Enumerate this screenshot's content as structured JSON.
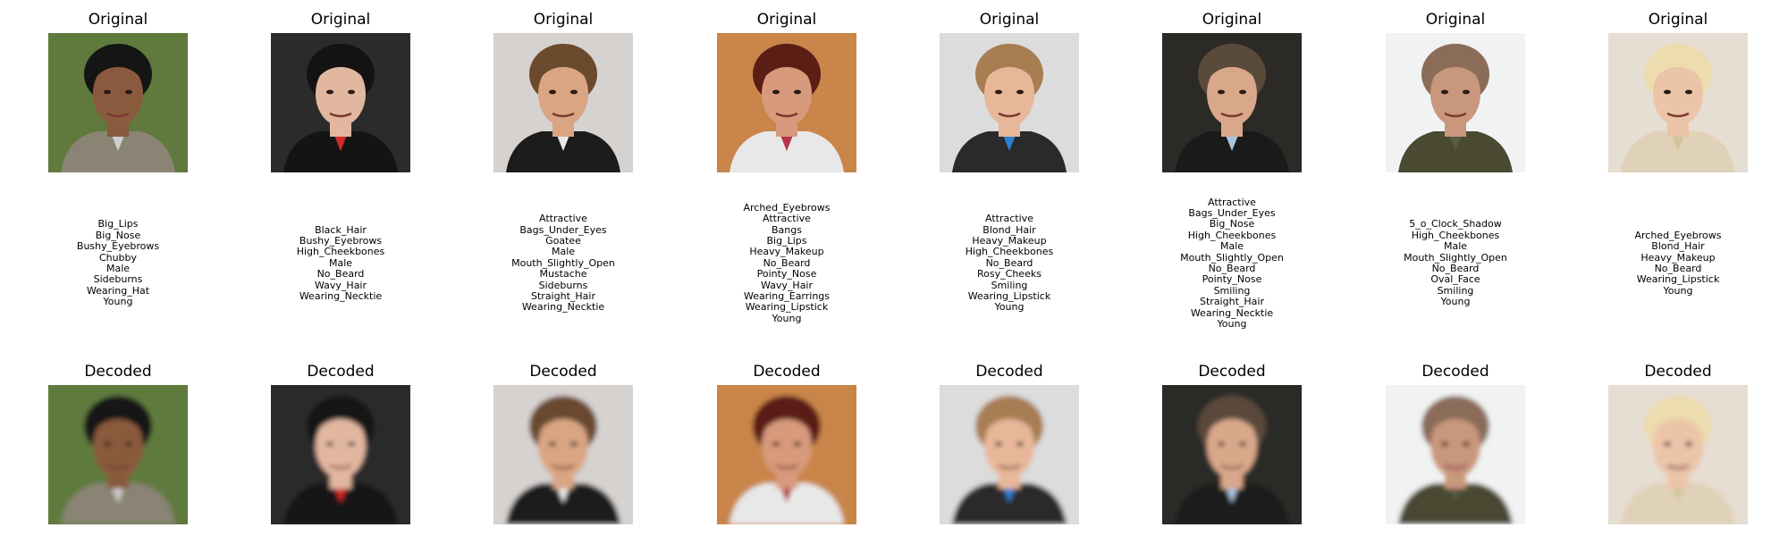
{
  "panels": [
    {
      "original_title": "Original",
      "decoded_title": "Decoded",
      "attributes": [
        "Big_Lips",
        "Big_Nose",
        "Bushy_Eyebrows",
        "Chubby",
        "Male",
        "Sideburns",
        "Wearing_Hat",
        "Young"
      ],
      "colors": {
        "bg": "#5f7a3c",
        "hair": "#151515",
        "skin": "#8a5a3e",
        "shirt": "#8a8474",
        "accent": "#cfcfcf"
      }
    },
    {
      "original_title": "Original",
      "decoded_title": "Decoded",
      "attributes": [
        "Black_Hair",
        "Bushy_Eyebrows",
        "High_Cheekbones",
        "Male",
        "No_Beard",
        "Wavy_Hair",
        "Wearing_Necktie"
      ],
      "colors": {
        "bg": "#2b2b2b",
        "hair": "#151212",
        "skin": "#e2b7a0",
        "shirt": "#141414",
        "accent": "#d22a2a"
      }
    },
    {
      "original_title": "Original",
      "decoded_title": "Decoded",
      "attributes": [
        "Attractive",
        "Bags_Under_Eyes",
        "Goatee",
        "Male",
        "Mouth_Slightly_Open",
        "Mustache",
        "Sideburns",
        "Straight_Hair",
        "Wearing_Necktie"
      ],
      "colors": {
        "bg": "#d6d2d0",
        "hair": "#6b4a2e",
        "skin": "#d9a582",
        "shirt": "#1c1c1c",
        "accent": "#e9e9e9"
      }
    },
    {
      "original_title": "Original",
      "decoded_title": "Decoded",
      "attributes": [
        "Arched_Eyebrows",
        "Attractive",
        "Bangs",
        "Big_Lips",
        "Heavy_Makeup",
        "No_Beard",
        "Pointy_Nose",
        "Wavy_Hair",
        "Wearing_Earrings",
        "Wearing_Lipstick",
        "Young"
      ],
      "colors": {
        "bg": "#c9854a",
        "hair": "#5a1e14",
        "skin": "#d89a7c",
        "shirt": "#e8e8e8",
        "accent": "#b8344a"
      }
    },
    {
      "original_title": "Original",
      "decoded_title": "Decoded",
      "attributes": [
        "Attractive",
        "Blond_Hair",
        "Heavy_Makeup",
        "High_Cheekbones",
        "No_Beard",
        "Rosy_Cheeks",
        "Smiling",
        "Wearing_Lipstick",
        "Young"
      ],
      "colors": {
        "bg": "#dcdcdc",
        "hair": "#a77d52",
        "skin": "#e8b79a",
        "shirt": "#2a2a2a",
        "accent": "#2f7fd0"
      }
    },
    {
      "original_title": "Original",
      "decoded_title": "Decoded",
      "attributes": [
        "Attractive",
        "Bags_Under_Eyes",
        "Big_Nose",
        "High_Cheekbones",
        "Male",
        "Mouth_Slightly_Open",
        "No_Beard",
        "Pointy_Nose",
        "Smiling",
        "Straight_Hair",
        "Wearing_Necktie",
        "Young"
      ],
      "colors": {
        "bg": "#2c2a26",
        "hair": "#5a4a3a",
        "skin": "#d9a88a",
        "shirt": "#1a1a1a",
        "accent": "#a9c4e0"
      }
    },
    {
      "original_title": "Original",
      "decoded_title": "Decoded",
      "attributes": [
        "5_o_Clock_Shadow",
        "High_Cheekbones",
        "Male",
        "Mouth_Slightly_Open",
        "No_Beard",
        "Oval_Face",
        "Smiling",
        "Young"
      ],
      "colors": {
        "bg": "#f1f3f3",
        "hair": "#8a6c58",
        "skin": "#c9977c",
        "shirt": "#4a4a32",
        "accent": "#5a5a40"
      }
    },
    {
      "original_title": "Original",
      "decoded_title": "Decoded",
      "attributes": [
        "Arched_Eyebrows",
        "Blond_Hair",
        "Heavy_Makeup",
        "No_Beard",
        "Wearing_Lipstick",
        "Young"
      ],
      "colors": {
        "bg": "#e6ddd3",
        "hair": "#ecdcae",
        "skin": "#ecc4a8",
        "shirt": "#e0d2b8",
        "accent": "#d4c49a"
      }
    }
  ]
}
